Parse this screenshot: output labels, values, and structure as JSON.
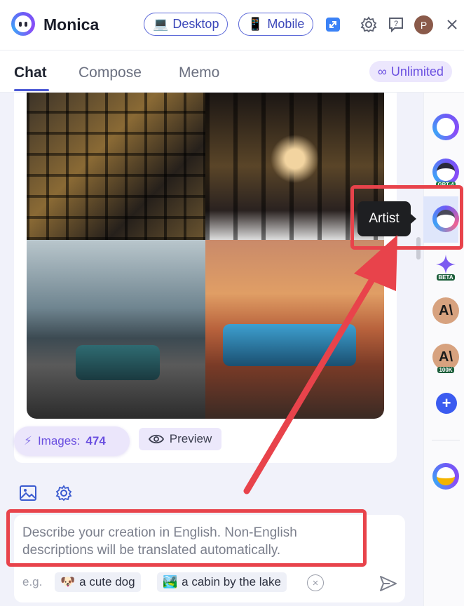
{
  "app": {
    "name": "Monica"
  },
  "header": {
    "desktop_label": "Desktop",
    "mobile_label": "Mobile",
    "avatar_initial": "P",
    "icons": [
      "expand-icon",
      "gear-icon",
      "help-icon",
      "close-icon"
    ]
  },
  "tabs": [
    {
      "label": "Chat",
      "active": true
    },
    {
      "label": "Compose",
      "active": false
    },
    {
      "label": "Memo",
      "active": false
    }
  ],
  "plan": {
    "label": "Unlimited"
  },
  "result": {
    "images_label": "Images:",
    "images_count": "474",
    "preview_label": "Preview"
  },
  "sidebar": {
    "tooltip": "Artist",
    "bots": [
      {
        "name": "monica-bot-icon"
      },
      {
        "name": "gpt4-bot-icon",
        "badge": "GPT-4"
      },
      {
        "name": "artist-bot-icon"
      },
      {
        "name": "gemini-bot-icon",
        "badge": "BETA"
      },
      {
        "name": "claude-bot-icon"
      },
      {
        "name": "claude-100k-bot-icon",
        "badge": "100K"
      },
      {
        "name": "add-bot-icon"
      },
      {
        "name": "mail-bot-icon"
      }
    ]
  },
  "composer": {
    "placeholder": "Describe your creation in English. Non-English descriptions will be translated automatically.",
    "examples_prefix": "e.g.",
    "examples": [
      {
        "emoji": "🐶",
        "text": "a cute dog"
      },
      {
        "emoji": "🏞️",
        "text": "a cabin by the lake"
      }
    ]
  },
  "colors": {
    "accent": "#4d5bd6",
    "highlight": "#e8434b",
    "purple": "#6a4fe0"
  }
}
